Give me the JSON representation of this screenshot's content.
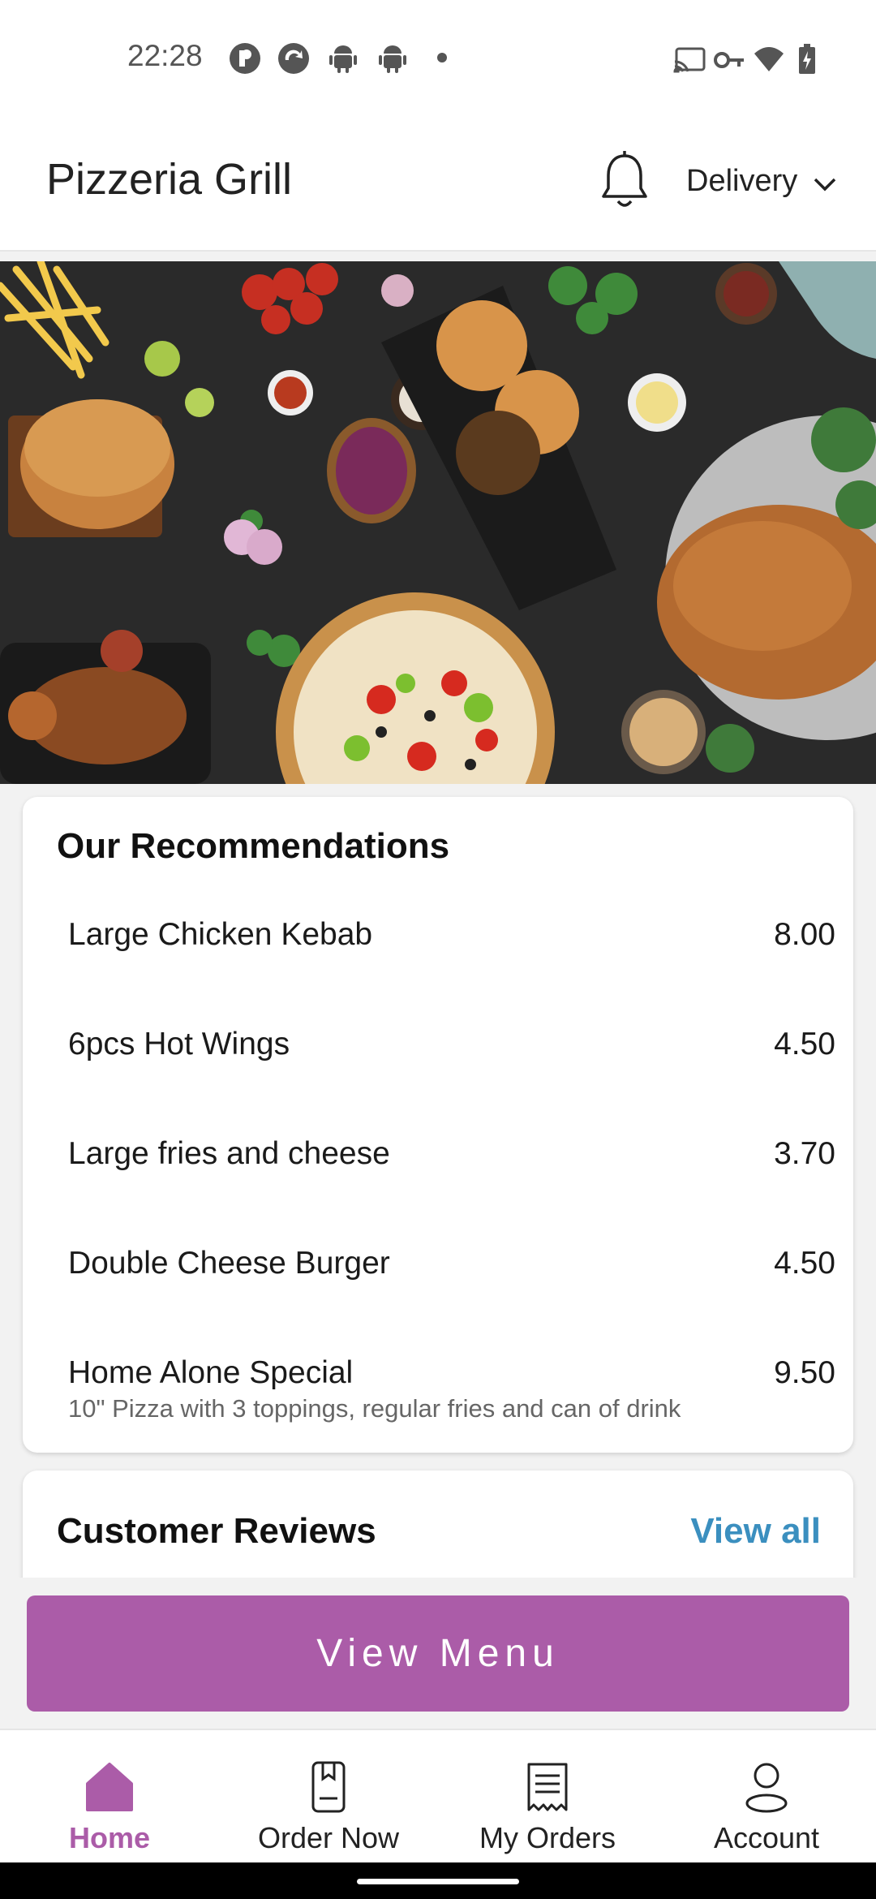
{
  "status_bar": {
    "time": "22:28",
    "left_icons": [
      "app-icon",
      "sync-icon",
      "android-icon",
      "android-icon",
      "dot-icon"
    ],
    "right_icons": [
      "cast-icon",
      "vpn-key-icon",
      "wifi-icon",
      "battery-charging-icon"
    ]
  },
  "header": {
    "title": "Pizzeria Grill",
    "delivery_label": "Delivery",
    "notification_icon": "bell-icon",
    "dropdown_icon": "chevron-down-icon"
  },
  "hero": {
    "image": "food-banner"
  },
  "recommendations": {
    "title": "Our Recommendations",
    "items": [
      {
        "name": "Large Chicken Kebab",
        "price": "8.00",
        "description": ""
      },
      {
        "name": "6pcs Hot Wings",
        "price": "4.50",
        "description": ""
      },
      {
        "name": "Large fries and cheese",
        "price": "3.70",
        "description": ""
      },
      {
        "name": "Double Cheese Burger",
        "price": "4.50",
        "description": ""
      },
      {
        "name": "Home Alone Special",
        "price": "9.50",
        "description": "10\" Pizza with 3 toppings, regular fries and can of drink"
      }
    ]
  },
  "reviews": {
    "title": "Customer Reviews",
    "view_all": "View all"
  },
  "view_menu_button": "View Menu",
  "bottom_nav": {
    "items": [
      {
        "label": "Home",
        "icon": "home-icon",
        "active": true
      },
      {
        "label": "Order Now",
        "icon": "order-icon",
        "active": false
      },
      {
        "label": "My Orders",
        "icon": "receipt-icon",
        "active": false
      },
      {
        "label": "Account",
        "icon": "person-icon",
        "active": false
      }
    ]
  },
  "colors": {
    "accent": "#ab5ca8",
    "link": "#3b8fbf"
  }
}
